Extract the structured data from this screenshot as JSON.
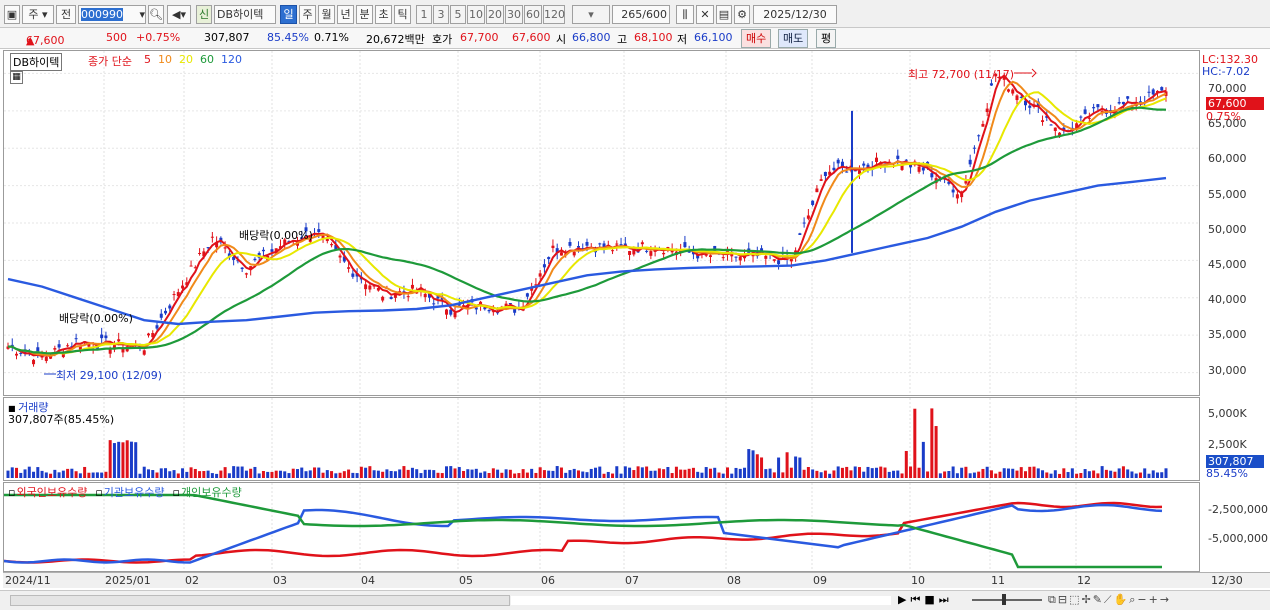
{
  "toolbar": {
    "period_mode": "주",
    "prev_label": "전",
    "code": "000990",
    "new_label": "신",
    "stock_name": "DB하이텍",
    "periods": [
      "일",
      "주",
      "월",
      "년",
      "분",
      "초",
      "틱"
    ],
    "active_period": "일",
    "minute_steps": [
      "1",
      "3",
      "5",
      "10",
      "20",
      "30",
      "60",
      "120"
    ],
    "count": "265",
    "count_total": "/600",
    "date": "2025/12/30"
  },
  "quote": {
    "price": "67,600",
    "change": "500",
    "change_pct": "+0.75%",
    "volume": "307,807",
    "vol_ratio": "85.45%",
    "turnover": "0.71%",
    "amount": "20,672백만",
    "bid_label": "호가",
    "bid1": "67,700",
    "bid2": "67,600",
    "open_label": "시",
    "open": "66,800",
    "high_label": "고",
    "high": "68,100",
    "low_label": "저",
    "low": "66,100",
    "buy_label": "매수",
    "sell_label": "매도",
    "eval_label": "평"
  },
  "price_panel": {
    "name_tag": "DB하이텍",
    "ma_label": "종가 단순",
    "ma": [
      {
        "n": "5",
        "color": "#e0121a"
      },
      {
        "n": "10",
        "color": "#f08a1a"
      },
      {
        "n": "20",
        "color": "#e8e800"
      },
      {
        "n": "60",
        "color": "#1e9a3a"
      },
      {
        "n": "120",
        "color": "#2a5ae0"
      }
    ],
    "lc": "LC:132.30",
    "hc": "HC:-7.02",
    "last_price": "67,600",
    "last_pct": "0.75%",
    "high_note": "최고 72,700 (11/17)",
    "low_note": "최저 29,100 (12/09)",
    "div_note1": "배당락(0.00%)",
    "div_note2": "배당락(0.00%)",
    "y_ticks": [
      "70,000",
      "65,000",
      "60,000",
      "55,000",
      "50,000",
      "45,000",
      "40,000",
      "35,000",
      "30,000"
    ]
  },
  "volume_panel": {
    "title": "거래량",
    "subtitle": "307,807주(85.45%)",
    "y_ticks": [
      "5,000K",
      "2,500K"
    ],
    "last": "307,807",
    "last_pct": "85.45%"
  },
  "holdings_panel": {
    "legend": [
      {
        "label": "외국인보유수량",
        "color": "#e0121a"
      },
      {
        "label": "기관보유수량",
        "color": "#2a5ae0"
      },
      {
        "label": "개인보유수량",
        "color": "#1e9a3a"
      }
    ],
    "y_ticks": [
      "-2,500,000",
      "-5,000,000"
    ]
  },
  "x_axis": [
    "2024/11",
    "2025/01",
    "02",
    "03",
    "04",
    "05",
    "06",
    "07",
    "08",
    "09",
    "10",
    "11",
    "12",
    "12/30"
  ],
  "chart_data": {
    "type": "line",
    "series": [
      {
        "name": "5",
        "values": [
          33500,
          32000,
          34200,
          33800,
          33500,
          41000,
          48000,
          44000,
          47000,
          49000,
          44000,
          40500,
          41000,
          38500,
          39000,
          38500,
          46500,
          47000,
          46500,
          47000,
          46000,
          45500,
          45500,
          45000,
          57000,
          57500,
          58500,
          57000,
          54000,
          70000,
          66000,
          62000,
          65000,
          66000,
          67600
        ]
      },
      {
        "name": "120",
        "values": [
          42500,
          41500,
          40000,
          38500,
          37000,
          36500,
          36800,
          37000,
          37500,
          38000,
          38200,
          38300,
          38500,
          39000,
          40000,
          41000,
          42000,
          43000,
          43500,
          43800,
          44000,
          44100,
          44200,
          44300,
          45000,
          46000,
          47000,
          48000,
          49500,
          51500,
          53000,
          54000,
          55000,
          55500,
          56000
        ]
      }
    ],
    "ylim": [
      27000,
      73000
    ]
  }
}
